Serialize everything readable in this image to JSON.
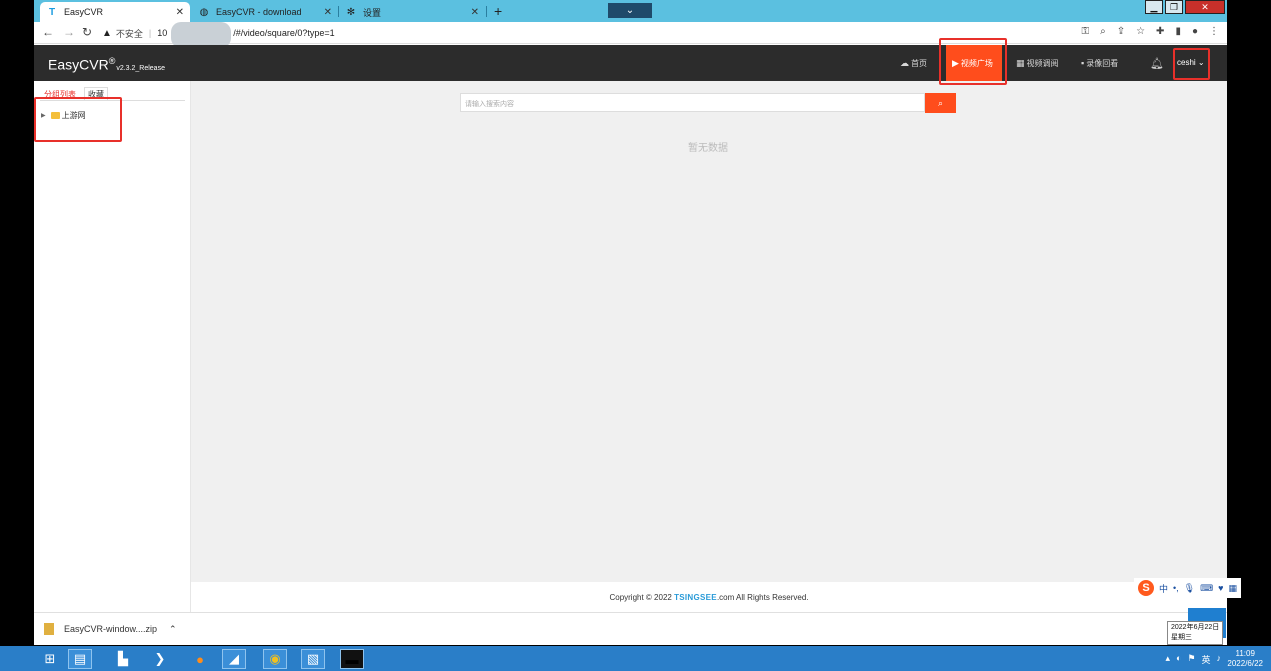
{
  "browser": {
    "tabs": [
      {
        "title": "EasyCVR",
        "icon": "T"
      },
      {
        "title": "EasyCVR - download",
        "icon": "globe-icon"
      },
      {
        "title": "设置",
        "icon": "gear-icon"
      }
    ],
    "new_tab": "+",
    "url_insecure": "不安全",
    "url_prefix": "10",
    "url_path": "/#/video/square/0?type=1"
  },
  "app": {
    "brand": "EasyCVR",
    "brand_mark": "®",
    "version": "v2.3.2_Release",
    "nav": [
      {
        "label": "首页",
        "icon": "cloud-icon"
      },
      {
        "label": "视频广场",
        "icon": "play-circle-icon"
      },
      {
        "label": "视频调阅",
        "icon": "grid-icon"
      },
      {
        "label": "录像回看",
        "icon": "camera-icon"
      }
    ],
    "user": "ceshi",
    "accent": "#ff4d1c"
  },
  "sidebar": {
    "tabs": [
      "分组列表",
      "收藏"
    ],
    "tree": [
      {
        "label": "上游网"
      }
    ]
  },
  "main": {
    "search_placeholder": "请输入搜索内容",
    "empty_text": "暂无数据",
    "footer_prefix": "Copyright © 2022",
    "footer_brand": "TSINGSEE",
    "footer_suffix": ".com All Rights Reserved."
  },
  "downloads": {
    "file": "EasyCVR-window....zip"
  },
  "ime": {
    "label": "中"
  },
  "system": {
    "tooltip_date": "2022年6月22日",
    "tooltip_day": "星期三",
    "time": "11:09",
    "date": "2022/6/22"
  }
}
